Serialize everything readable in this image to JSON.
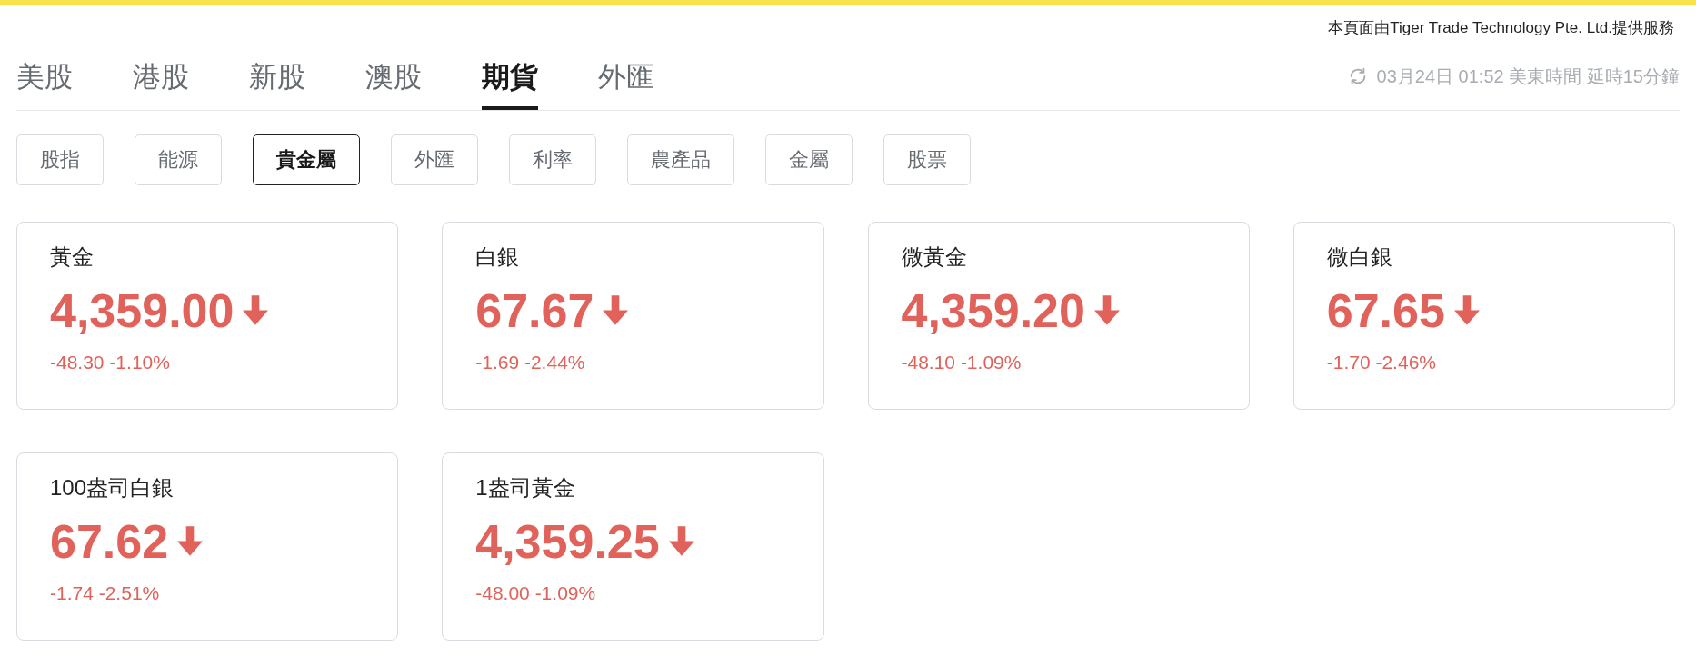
{
  "provider_note": "本頁面由Tiger Trade Technology Pte. Ltd.提供服務",
  "market_tabs": [
    {
      "label": "美股",
      "selected": false
    },
    {
      "label": "港股",
      "selected": false
    },
    {
      "label": "新股",
      "selected": false
    },
    {
      "label": "澳股",
      "selected": false
    },
    {
      "label": "期貨",
      "selected": true
    },
    {
      "label": "外匯",
      "selected": false
    }
  ],
  "timestamp": "03月24日 01:52 美東時間 延時15分鐘",
  "category_chips": [
    {
      "label": "股指",
      "selected": false
    },
    {
      "label": "能源",
      "selected": false
    },
    {
      "label": "貴金屬",
      "selected": true
    },
    {
      "label": "外匯",
      "selected": false
    },
    {
      "label": "利率",
      "selected": false
    },
    {
      "label": "農產品",
      "selected": false
    },
    {
      "label": "金屬",
      "selected": false
    },
    {
      "label": "股票",
      "selected": false
    }
  ],
  "quotes": [
    {
      "name": "黃金",
      "price": "4,359.00",
      "change": "-48.30 -1.10%",
      "kind": "falling"
    },
    {
      "name": "白銀",
      "price": "67.67",
      "change": "-1.69 -2.44%",
      "kind": "falling"
    },
    {
      "name": "微黃金",
      "price": "4,359.20",
      "change": "-48.10 -1.09%",
      "kind": "falling"
    },
    {
      "name": "微白銀",
      "price": "67.65",
      "change": "-1.70 -2.46%",
      "kind": "falling"
    },
    {
      "name": "100盎司白銀",
      "price": "67.62",
      "change": "-1.74 -2.51%",
      "kind": "falling"
    },
    {
      "name": "1盎司黃金",
      "price": "4,359.25",
      "change": "-48.00 -1.09%",
      "kind": "falling"
    }
  ]
}
